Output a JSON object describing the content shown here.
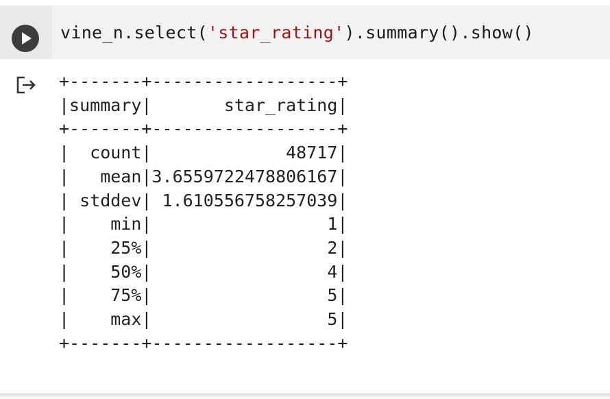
{
  "cell": {
    "code": {
      "prefix": "vine_n.select(",
      "string_literal": "'star_rating'",
      "suffix": ").summary().show()"
    },
    "run_button_icon": "play-icon",
    "output_icon": "output-redirect-icon",
    "output_lines": [
      "+-------+------------------+",
      "|summary|       star_rating|",
      "+-------+------------------+",
      "|  count|             48717|",
      "|   mean|3.6559722478806167|",
      "| stddev| 1.610556758257039|",
      "|    min|                 1|",
      "|    25%|                 2|",
      "|    50%|                 4|",
      "|    75%|                 5|",
      "|    max|                 5|",
      "+-------+------------------+"
    ]
  },
  "colors": {
    "string_literal": "#a31515",
    "run_button": "#3c3c3c",
    "editor_background": "#f2f2f2"
  }
}
